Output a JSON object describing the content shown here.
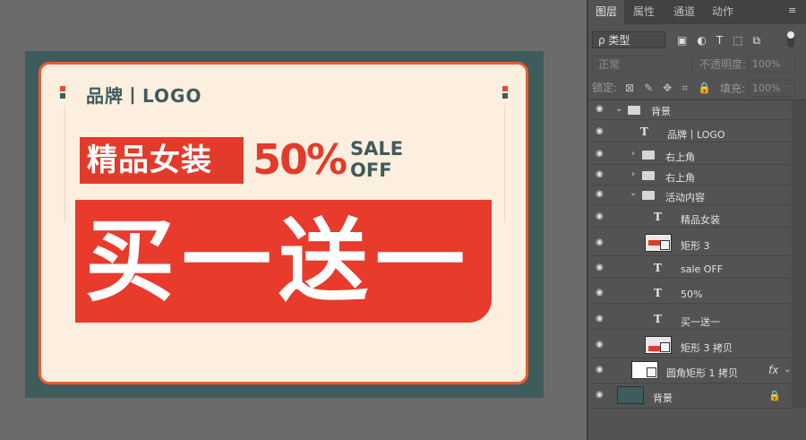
{
  "canvas": {
    "brand_text": "品牌丨LOGO",
    "tag_text": "精品女装",
    "percent_text": "50%",
    "sale_line1": "SALE",
    "sale_line2": "OFF",
    "banner_text": "买一送一",
    "colors": {
      "accent_red": "#e33b2b",
      "border_orange": "#e45f2b",
      "teal_bg": "#3f5b5b",
      "card_bg": "#fdefdf"
    }
  },
  "panel": {
    "tabs": [
      "图层",
      "属性",
      "通道",
      "动作"
    ],
    "filter_label": "ρ 类型",
    "blend_mode": "正常",
    "opacity_label": "不透明度:",
    "opacity_value": "100%",
    "lock_label": "锁定:",
    "fill_label": "填充:",
    "fill_value": "100%",
    "layers": [
      {
        "name": "背景",
        "kind": "group-open"
      },
      {
        "name": "品牌丨LOGO",
        "kind": "text"
      },
      {
        "name": "右上角",
        "kind": "group-closed"
      },
      {
        "name": "右上角",
        "kind": "group-closed"
      },
      {
        "name": "活动内容",
        "kind": "group-open"
      },
      {
        "name": "精品女装",
        "kind": "text"
      },
      {
        "name": "矩形 3",
        "kind": "shape"
      },
      {
        "name": "sale OFF",
        "kind": "text"
      },
      {
        "name": "50%",
        "kind": "text"
      },
      {
        "name": "买一送一",
        "kind": "text"
      },
      {
        "name": "矩形 3 拷贝",
        "kind": "shape"
      },
      {
        "name": "圆角矩形 1 拷贝",
        "kind": "shape-fx"
      },
      {
        "name": "背景",
        "kind": "background"
      }
    ]
  }
}
